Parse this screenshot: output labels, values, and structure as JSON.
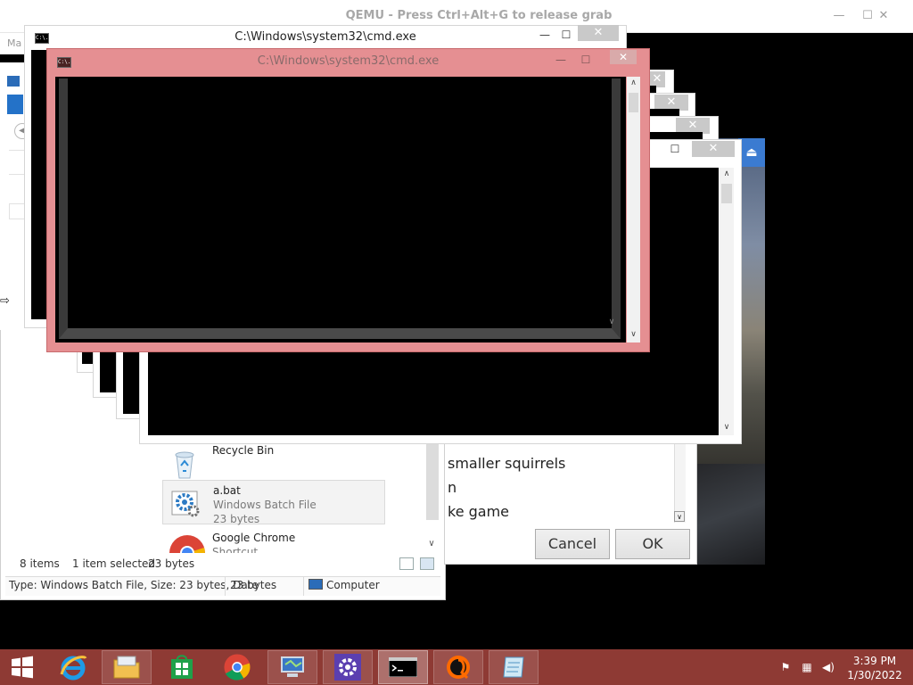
{
  "qemu": {
    "title": "QEMU - Press Ctrl+Alt+G to release grab",
    "minimize_glyph": "—",
    "maximize_glyph": "☐",
    "close_glyph": "✕",
    "menu_stub": "Ma"
  },
  "cmd_windows": {
    "back_title": "C:\\Windows\\system32\\cmd.exe",
    "active_title": "C:\\Windows\\system32\\cmd.exe",
    "icon_text": "C:\\.",
    "minimize_glyph": "—",
    "maximize_glyph": "☐",
    "close_glyph": "✕"
  },
  "explorer": {
    "files": [
      {
        "name": "Recycle Bin",
        "type": "",
        "size": ""
      },
      {
        "name": "a.bat",
        "type": "Windows Batch File",
        "size": "23 bytes"
      },
      {
        "name": "Google Chrome",
        "type": "Shortcut",
        "size": ""
      }
    ],
    "status_items": "8 items",
    "status_selected": "1 item selected",
    "status_size": "23 bytes",
    "details_text": "Type: Windows Batch File, Size: 23 bytes, Date",
    "details_size": "23 bytes",
    "details_location": "Computer"
  },
  "dialog": {
    "list_items": [
      "smaller squirrels",
      "n",
      "ke game"
    ],
    "cancel_label": "Cancel",
    "ok_label": "OK"
  },
  "taskbar": {
    "items": [
      "start-button",
      "internet-explorer",
      "file-explorer",
      "windows-store",
      "google-chrome",
      "control-panel",
      "settings",
      "command-prompt",
      "qemu-app",
      "notepad-app"
    ],
    "time": "3:39 PM",
    "date": "1/30/2022"
  },
  "colors": {
    "taskbar": "#8e3a34",
    "active_frame": "#e58f92",
    "accent_blue": "#2472c8"
  }
}
